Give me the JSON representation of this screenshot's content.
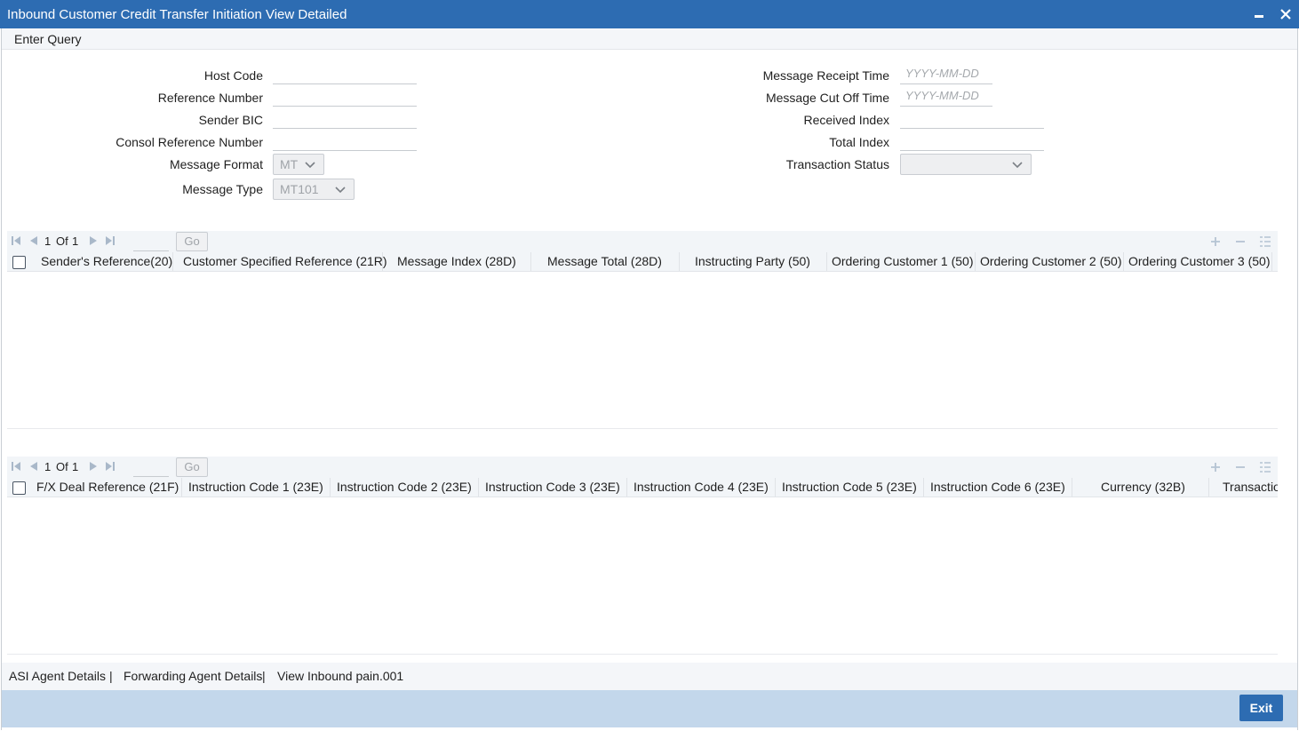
{
  "window": {
    "title": "Inbound Customer Credit Transfer Initiation View Detailed"
  },
  "menu": {
    "enter_query": "Enter Query"
  },
  "form": {
    "left": {
      "host_code": {
        "label": "Host Code",
        "value": ""
      },
      "reference_number": {
        "label": "Reference Number",
        "value": ""
      },
      "sender_bic": {
        "label": "Sender BIC",
        "value": ""
      },
      "consol_reference_number": {
        "label": "Consol Reference Number",
        "value": ""
      },
      "message_format": {
        "label": "Message Format",
        "value": "MT"
      },
      "message_type": {
        "label": "Message Type",
        "value": "MT101"
      }
    },
    "right": {
      "message_receipt_time": {
        "label": "Message Receipt Time",
        "placeholder": "YYYY-MM-DD",
        "value": ""
      },
      "message_cut_off_time": {
        "label": "Message Cut Off Time",
        "placeholder": "YYYY-MM-DD",
        "value": ""
      },
      "received_index": {
        "label": "Received Index",
        "value": ""
      },
      "total_index": {
        "label": "Total Index",
        "value": ""
      },
      "transaction_status": {
        "label": "Transaction Status",
        "value": ""
      }
    }
  },
  "grid1": {
    "pager": {
      "current": "1",
      "of_label": "Of",
      "total": "1",
      "go_label": "Go"
    },
    "columns": [
      "Sender's Reference(20)",
      "Customer Specified Reference (21R)",
      "Message Index (28D)",
      "Message Total (28D)",
      "Instructing Party (50)",
      "Ordering Customer 1 (50)",
      "Ordering Customer 2 (50)",
      "Ordering Customer 3 (50)"
    ]
  },
  "grid2": {
    "pager": {
      "current": "1",
      "of_label": "Of",
      "total": "1",
      "go_label": "Go"
    },
    "columns": [
      "F/X Deal Reference (21F)",
      "Instruction Code 1 (23E)",
      "Instruction Code 2 (23E)",
      "Instruction Code 3 (23E)",
      "Instruction Code 4 (23E)",
      "Instruction Code 5 (23E)",
      "Instruction Code 6 (23E)",
      "Currency (32B)",
      "Transaction"
    ]
  },
  "footer": {
    "links": [
      "ASI Agent Details",
      "Forwarding Agent Details",
      "View Inbound pain.001"
    ],
    "separator": "|",
    "exit_label": "Exit"
  },
  "colors": {
    "title_bar": "#2d6cb2",
    "footer_bar": "#c3d7eb",
    "exit_button": "#2d6cb2"
  }
}
